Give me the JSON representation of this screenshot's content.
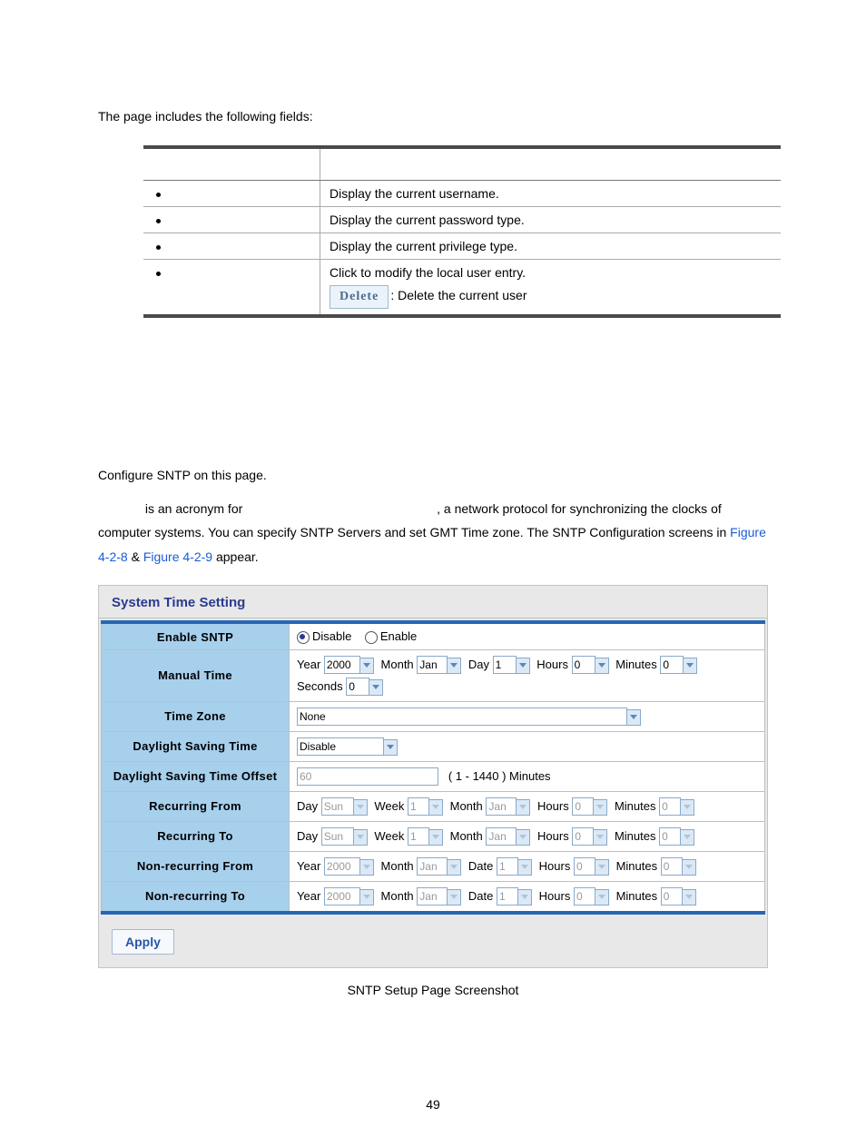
{
  "intro": "The page includes the following fields:",
  "fields_table": {
    "rows": [
      {
        "desc": "Display the current username."
      },
      {
        "desc": "Display the current password type."
      },
      {
        "desc": "Display the current privilege type."
      },
      {
        "desc": "Click to modify the local user entry.",
        "has_delete": true,
        "delete_label": "Delete",
        "delete_suffix": ": Delete the current user"
      }
    ]
  },
  "sntp_intro": {
    "line1": "Configure SNTP on this page.",
    "acronym_prefix": " is an acronym for ",
    "acronym_suffix": ", a network protocol for synchronizing the clocks of computer systems. You can specify SNTP Servers and set GMT Time zone. The SNTP Configuration screens in ",
    "fig1": "Figure 4-2-8",
    "amp": " & ",
    "fig2": "Figure 4-2-9",
    "appear": " appear."
  },
  "panel": {
    "title": "System Time Setting",
    "rows": {
      "enable_sntp": {
        "label": "Enable SNTP",
        "opt_disable": "Disable",
        "opt_enable": "Enable",
        "selected": "disable"
      },
      "manual_time": {
        "label": "Manual Time",
        "year_l": "Year",
        "year_v": "2000",
        "month_l": "Month",
        "month_v": "Jan",
        "day_l": "Day",
        "day_v": "1",
        "hours_l": "Hours",
        "hours_v": "0",
        "minutes_l": "Minutes",
        "minutes_v": "0",
        "seconds_l": "Seconds",
        "seconds_v": "0"
      },
      "time_zone": {
        "label": "Time Zone",
        "value": "None"
      },
      "dst": {
        "label": "Daylight Saving Time",
        "value": "Disable"
      },
      "dst_offset": {
        "label": "Daylight Saving Time Offset",
        "value": "60",
        "hint": "( 1 - 1440 ) Minutes"
      },
      "recur_from": {
        "label": "Recurring From",
        "day_l": "Day",
        "day_v": "Sun",
        "week_l": "Week",
        "week_v": "1",
        "month_l": "Month",
        "month_v": "Jan",
        "hours_l": "Hours",
        "hours_v": "0",
        "minutes_l": "Minutes",
        "minutes_v": "0"
      },
      "recur_to": {
        "label": "Recurring To",
        "day_l": "Day",
        "day_v": "Sun",
        "week_l": "Week",
        "week_v": "1",
        "month_l": "Month",
        "month_v": "Jan",
        "hours_l": "Hours",
        "hours_v": "0",
        "minutes_l": "Minutes",
        "minutes_v": "0"
      },
      "nrecur_from": {
        "label": "Non-recurring From",
        "year_l": "Year",
        "year_v": "2000",
        "month_l": "Month",
        "month_v": "Jan",
        "date_l": "Date",
        "date_v": "1",
        "hours_l": "Hours",
        "hours_v": "0",
        "minutes_l": "Minutes",
        "minutes_v": "0"
      },
      "nrecur_to": {
        "label": "Non-recurring To",
        "year_l": "Year",
        "year_v": "2000",
        "month_l": "Month",
        "month_v": "Jan",
        "date_l": "Date",
        "date_v": "1",
        "hours_l": "Hours",
        "hours_v": "0",
        "minutes_l": "Minutes",
        "minutes_v": "0"
      }
    },
    "apply_label": "Apply"
  },
  "caption": "SNTP Setup Page Screenshot",
  "page_number": "49"
}
